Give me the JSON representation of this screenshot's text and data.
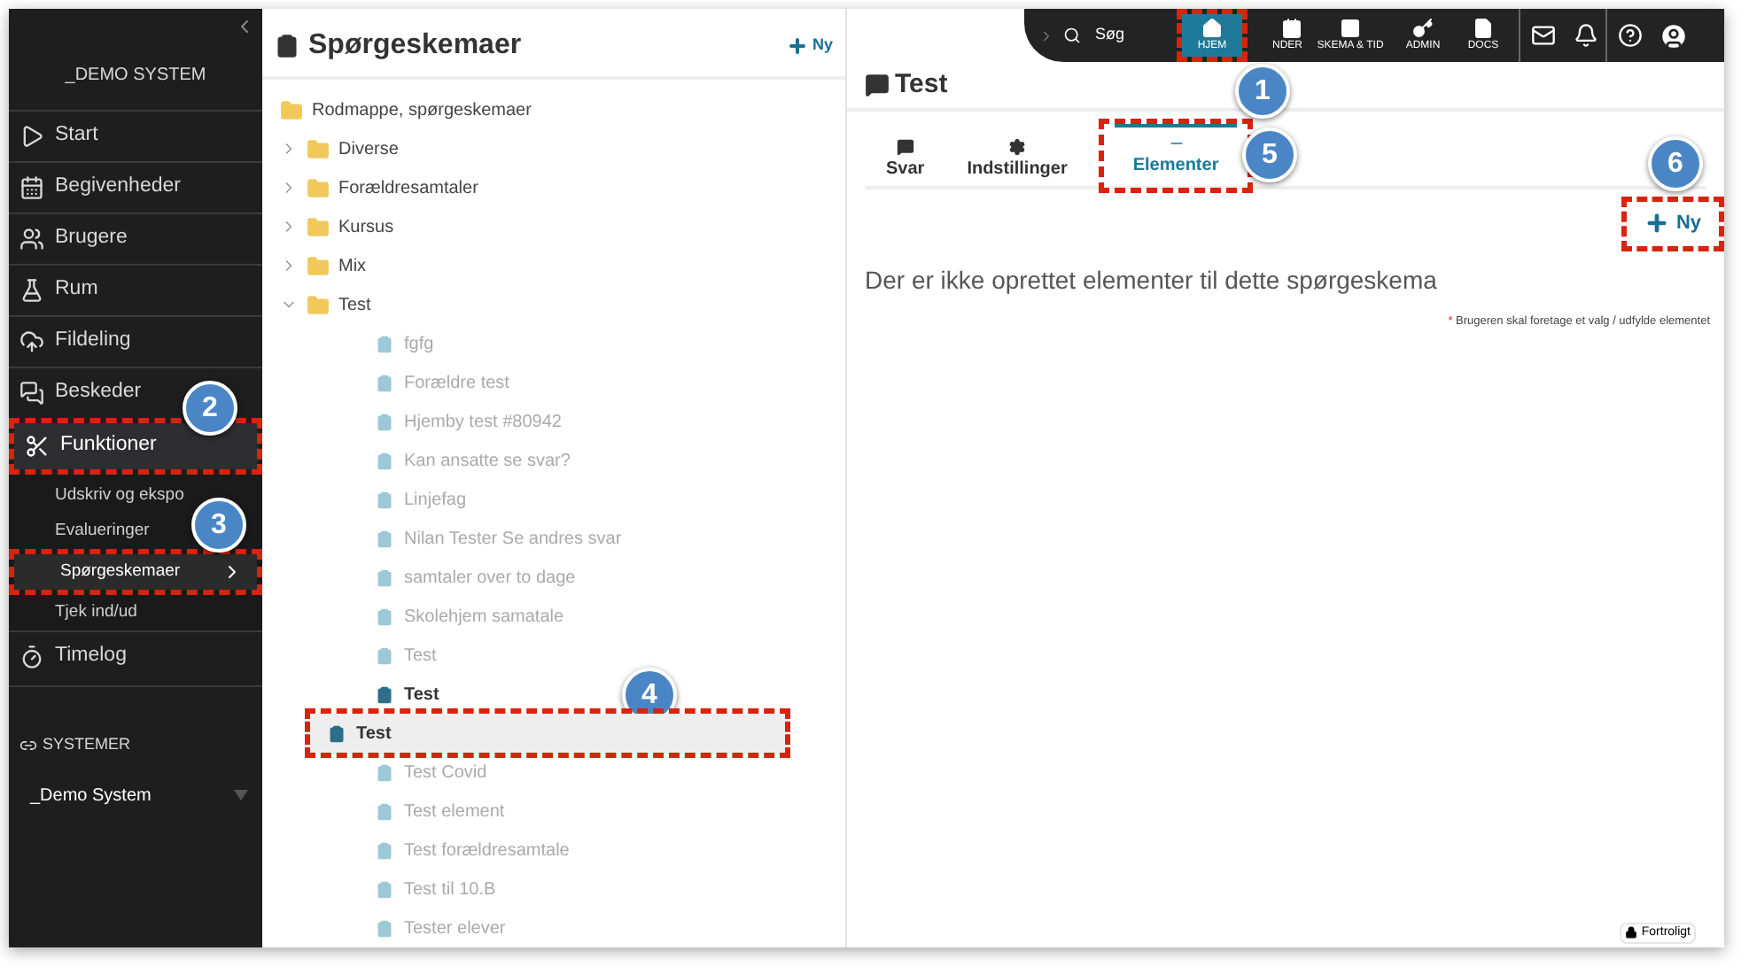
{
  "sidebar": {
    "system_title": "_DEMO SYSTEM",
    "items": [
      {
        "label": "Start",
        "selected": false
      },
      {
        "label": "Begivenheder",
        "selected": false
      },
      {
        "label": "Brugere",
        "selected": false
      },
      {
        "label": "Rum",
        "selected": false
      },
      {
        "label": "Fildeling",
        "selected": false
      },
      {
        "label": "Beskeder",
        "selected": false
      },
      {
        "label": "Funktioner",
        "selected": true,
        "expanded": true,
        "children": [
          {
            "label": "Udskriv og ekspo",
            "selected": false
          },
          {
            "label": "Evalueringer",
            "selected": false
          },
          {
            "label": "Spørgeskemaer",
            "selected": true
          },
          {
            "label": "Tjek ind/ud",
            "selected": false
          }
        ]
      },
      {
        "label": "Timelog",
        "selected": false
      }
    ],
    "section_label": "SYSTEMER",
    "system_select": "_Demo System"
  },
  "tree_panel": {
    "title": "Spørgeskemaer",
    "new_button": "Ny",
    "root": "Rodmappe, spørgeskemaer",
    "folders": [
      {
        "label": "Diverse",
        "expanded": false
      },
      {
        "label": "Forældresamtaler",
        "expanded": false
      },
      {
        "label": "Kursus",
        "expanded": false
      },
      {
        "label": "Mix",
        "expanded": false
      },
      {
        "label": "Test",
        "expanded": true,
        "children": [
          {
            "label": "fgfg",
            "active": false,
            "selected": false
          },
          {
            "label": "Forældre test",
            "active": false,
            "selected": false
          },
          {
            "label": "Hjemby test #80942",
            "active": false,
            "selected": false
          },
          {
            "label": "Kan ansatte se svar?",
            "active": false,
            "selected": false
          },
          {
            "label": "Linjefag",
            "active": false,
            "selected": false
          },
          {
            "label": "Nilan Tester Se andres svar",
            "active": false,
            "selected": false
          },
          {
            "label": "samtaler over to dage",
            "active": false,
            "selected": false
          },
          {
            "label": "Skolehjem samatale",
            "active": false,
            "selected": false
          },
          {
            "label": "Test",
            "active": false,
            "selected": false
          },
          {
            "label": "Test",
            "active": true,
            "selected": false
          },
          {
            "label": "Test",
            "active": true,
            "selected": true
          },
          {
            "label": "Test Covid",
            "active": false,
            "selected": false
          },
          {
            "label": "Test element",
            "active": false,
            "selected": false
          },
          {
            "label": "Test forældresamtale",
            "active": false,
            "selected": false
          },
          {
            "label": "Test til 10.B",
            "active": false,
            "selected": false
          },
          {
            "label": "Tester elever",
            "active": false,
            "selected": false
          }
        ]
      }
    ]
  },
  "top_bar": {
    "search": "Søg",
    "nav": [
      {
        "label": "HJEM",
        "selected": true
      },
      {
        "label": "NDER",
        "selected": false
      },
      {
        "label": "SKEMA & TID",
        "selected": false
      },
      {
        "label": "ADMIN",
        "selected": false
      },
      {
        "label": "DOCS",
        "selected": false
      }
    ]
  },
  "detail": {
    "title": "Test",
    "tabs": [
      {
        "label": "Svar",
        "selected": false
      },
      {
        "label": "Indstillinger",
        "selected": false
      },
      {
        "label": "Elementer",
        "selected": true
      }
    ],
    "new_button": "Ny",
    "empty_message": "Der er ikke oprettet elementer til dette spørgeskema",
    "note_mark": "*",
    "note": "Brugeren skal foretage et valg / udfylde elementet",
    "confidential_badge": "Fortroligt"
  },
  "annotations": [
    {
      "number": "1"
    },
    {
      "number": "2"
    },
    {
      "number": "3"
    },
    {
      "number": "4"
    },
    {
      "number": "5"
    },
    {
      "number": "6"
    }
  ]
}
